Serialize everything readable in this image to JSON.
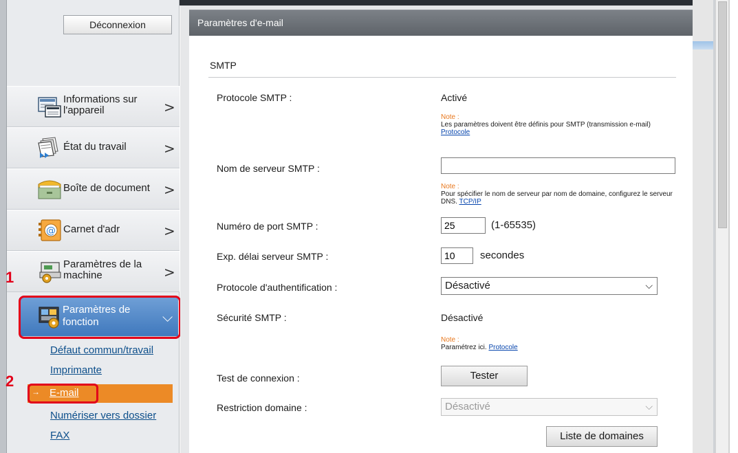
{
  "sidebar": {
    "logout_label": "Déconnexion",
    "items": [
      {
        "line1": "Informations sur",
        "line2": "l'appareil",
        "chevron": ">"
      },
      {
        "line1": "État du travail",
        "line2": "",
        "chevron": ">"
      },
      {
        "line1": "Boîte de document",
        "line2": "",
        "chevron": ">"
      },
      {
        "line1": "Carnet d'adr",
        "line2": "",
        "chevron": ">"
      },
      {
        "line1": "Paramètres de la",
        "line2": "machine",
        "chevron": ">"
      },
      {
        "line1": "Paramètres de",
        "line2": "fonction",
        "chevron": "⌵"
      }
    ],
    "sub_items": [
      "Défaut commun/travail",
      "Imprimante",
      "E-mail",
      "Numériser vers dossier",
      "FAX"
    ],
    "active_sub_arrow": "→"
  },
  "steps": [
    "1",
    "2"
  ],
  "header": {
    "title": "Paramètres d'e-mail"
  },
  "section": {
    "title": "SMTP"
  },
  "rows": {
    "smtp_protocol": {
      "label": "Protocole SMTP :",
      "value": "Activé"
    },
    "note1": {
      "title": "Note :",
      "text": "Les paramètres doivent être définis pour SMTP (transmission e-mail)",
      "link": "Protocole"
    },
    "server_name": {
      "label": "Nom de serveur SMTP :",
      "value": ""
    },
    "note2": {
      "title": "Note :",
      "text": "Pour spécifier le nom de serveur par nom de domaine, configurez le serveur DNS.",
      "link": "TCP/IP"
    },
    "port": {
      "label": "Numéro de port SMTP :",
      "value": "25",
      "suffix": "(1-65535)"
    },
    "timeout": {
      "label": "Exp. délai serveur SMTP :",
      "value": "10",
      "suffix": "secondes"
    },
    "auth": {
      "label": "Protocole d'authentification :",
      "value": "Désactivé"
    },
    "security": {
      "label": "Sécurité SMTP :",
      "value": "Désactivé"
    },
    "note3": {
      "title": "Note :",
      "text": "Paramétrez ici.",
      "link": "Protocole"
    },
    "test": {
      "label": "Test de connexion :",
      "button": "Tester"
    },
    "domain": {
      "label": "Restriction domaine :",
      "value": "Désactivé",
      "button": "Liste de domaines"
    }
  },
  "colors": {
    "accent_blue": "#3f78bd",
    "highlight_orange": "#ec8a26",
    "annotation_red": "#e2001a",
    "note_orange": "#e8781e"
  }
}
